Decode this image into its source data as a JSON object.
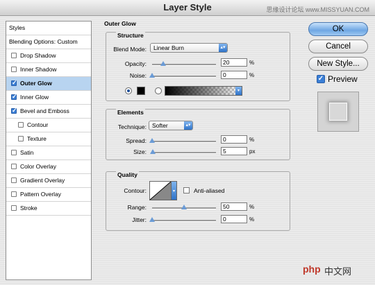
{
  "window": {
    "title": "Layer Style",
    "watermark": "思缘设计论坛 www.MISSYUAN.COM"
  },
  "styles_list": {
    "header": "Styles",
    "blending": "Blending Options: Custom",
    "items": [
      {
        "label": "Drop Shadow",
        "checked": false,
        "sub": false,
        "selected": false
      },
      {
        "label": "Inner Shadow",
        "checked": false,
        "sub": false,
        "selected": false
      },
      {
        "label": "Outer Glow",
        "checked": true,
        "sub": false,
        "selected": true
      },
      {
        "label": "Inner Glow",
        "checked": true,
        "sub": false,
        "selected": false
      },
      {
        "label": "Bevel and Emboss",
        "checked": true,
        "sub": false,
        "selected": false
      },
      {
        "label": "Contour",
        "checked": false,
        "sub": true,
        "selected": false
      },
      {
        "label": "Texture",
        "checked": false,
        "sub": true,
        "selected": false
      },
      {
        "label": "Satin",
        "checked": false,
        "sub": false,
        "selected": false
      },
      {
        "label": "Color Overlay",
        "checked": false,
        "sub": false,
        "selected": false
      },
      {
        "label": "Gradient Overlay",
        "checked": false,
        "sub": false,
        "selected": false
      },
      {
        "label": "Pattern Overlay",
        "checked": false,
        "sub": false,
        "selected": false
      },
      {
        "label": "Stroke",
        "checked": false,
        "sub": false,
        "selected": false
      }
    ]
  },
  "panel": {
    "title": "Outer Glow",
    "structure": {
      "title": "Structure",
      "blend_mode_label": "Blend Mode:",
      "blend_mode": "Linear Burn",
      "opacity_label": "Opacity:",
      "opacity": "20",
      "opacity_unit": "%",
      "noise_label": "Noise:",
      "noise": "0",
      "noise_unit": "%"
    },
    "elements": {
      "title": "Elements",
      "technique_label": "Technique:",
      "technique": "Softer",
      "spread_label": "Spread:",
      "spread": "0",
      "spread_unit": "%",
      "size_label": "Size:",
      "size": "5",
      "size_unit": "px"
    },
    "quality": {
      "title": "Quality",
      "contour_label": "Contour:",
      "anti_aliased_label": "Anti-aliased",
      "range_label": "Range:",
      "range": "50",
      "range_unit": "%",
      "jitter_label": "Jitter:",
      "jitter": "0",
      "jitter_unit": "%"
    }
  },
  "buttons": {
    "ok": "OK",
    "cancel": "Cancel",
    "new_style": "New Style...",
    "preview": "Preview"
  }
}
